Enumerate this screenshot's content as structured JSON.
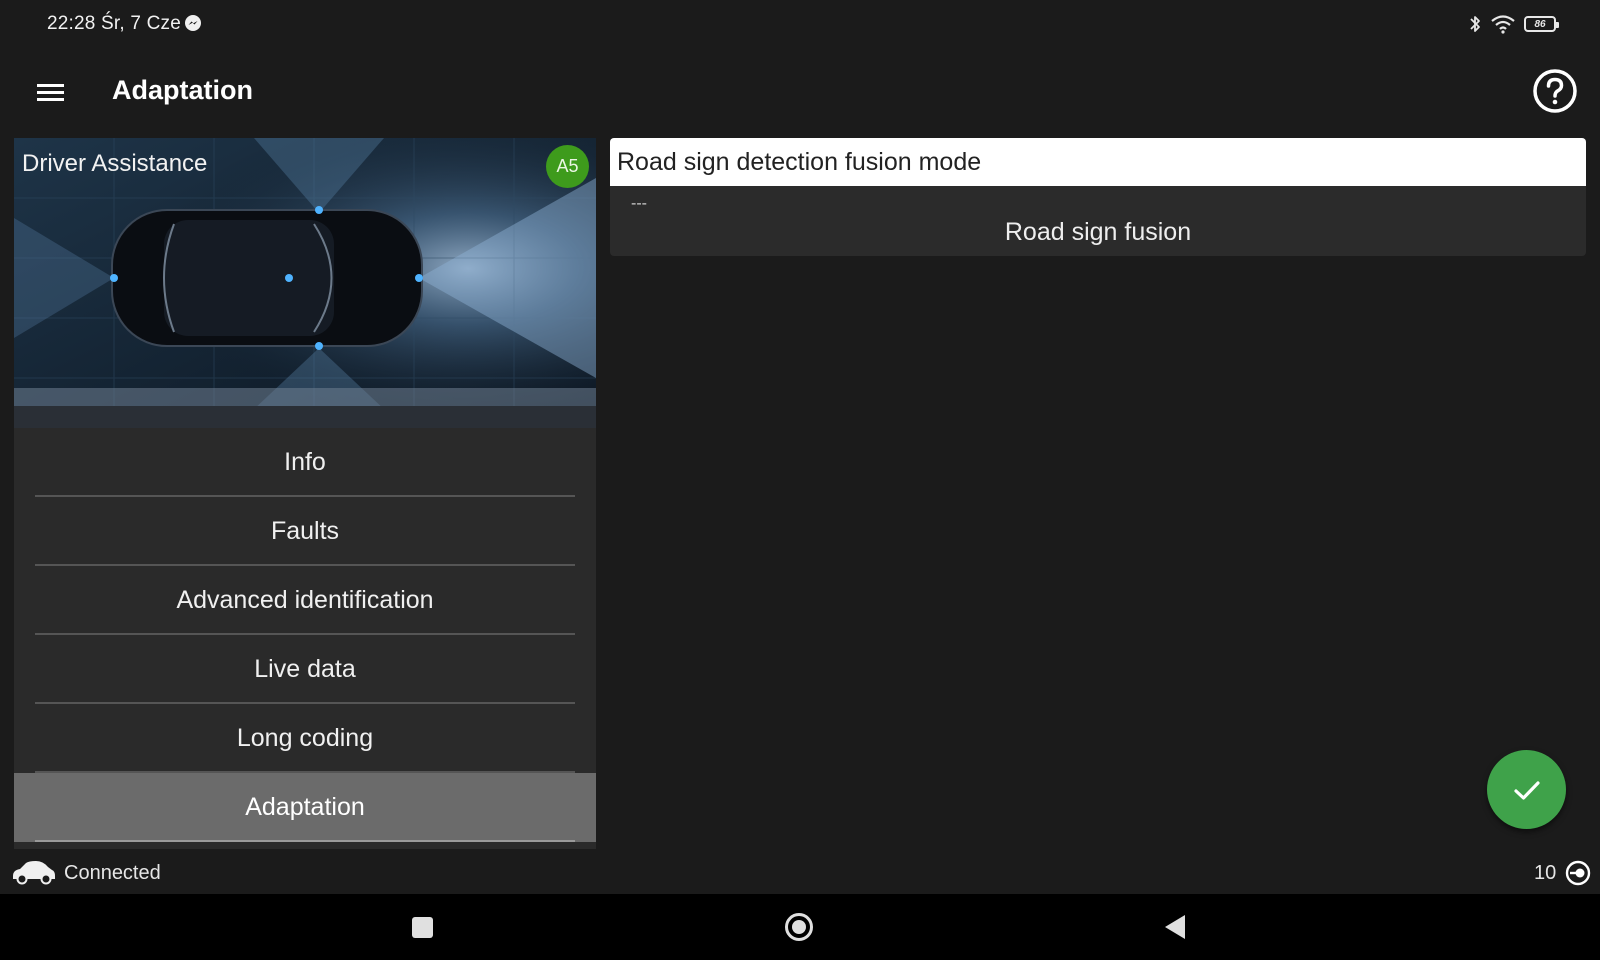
{
  "status_bar": {
    "time": "22:28 Śr, 7 Cze",
    "battery": "86",
    "icons": [
      "messenger-icon",
      "bluetooth-icon",
      "wifi-icon",
      "battery-icon"
    ]
  },
  "app_bar": {
    "title": "Adaptation",
    "icons": [
      "hamburger-menu-icon",
      "help-icon"
    ]
  },
  "module": {
    "name": "Driver Assistance",
    "badge": "A5"
  },
  "menu": {
    "items": [
      {
        "label": "Info"
      },
      {
        "label": "Faults"
      },
      {
        "label": "Advanced identification"
      },
      {
        "label": "Live data"
      },
      {
        "label": "Long coding"
      },
      {
        "label": "Adaptation",
        "active": true
      }
    ]
  },
  "parameter": {
    "name": "Road sign detection fusion mode",
    "previous_value": "---",
    "value": "Road sign fusion"
  },
  "footer": {
    "connection_status": "Connected",
    "count": "10"
  },
  "colors": {
    "background": "#1b1b1b",
    "panel": "#2a2a2a",
    "active_item": "#6b6b6b",
    "badge": "#3e9b1c",
    "fab": "#3fa24a"
  }
}
